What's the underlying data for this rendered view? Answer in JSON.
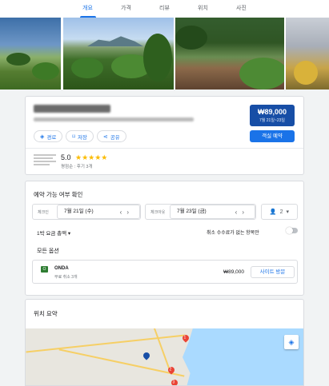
{
  "tabs": [
    {
      "label": "개요",
      "active": true
    },
    {
      "label": "가격",
      "active": false
    },
    {
      "label": "리뷰",
      "active": false
    },
    {
      "label": "위치",
      "active": false
    },
    {
      "label": "사진",
      "active": false
    }
  ],
  "hotel": {
    "chips": [
      {
        "icon": "directions-icon",
        "label": "경로"
      },
      {
        "icon": "bookmark-icon",
        "label": "저장"
      },
      {
        "icon": "share-icon",
        "label": "공유"
      }
    ],
    "price": "₩89,000",
    "price_dates": "7월 21일~23일",
    "book_label": "객실 예약",
    "rating": "5.0",
    "stars": "★★★★★",
    "rating_sub": "평점순 : 후기 3개"
  },
  "availability": {
    "title": "예약 가능 여부 확인",
    "checkin_label": "체크인",
    "checkin_value": "7월 21일 (수)",
    "checkout_label": "체크아웃",
    "checkout_value": "7월 23일 (금)",
    "guests": "2",
    "rate_select": "1박 요금 총액 ▾",
    "free_cancel": "취소 수수료가 없는 항목만",
    "all_options": "모든 옵션",
    "option": {
      "logo": "O",
      "name": "ONDA",
      "sub": "무료 취소 3개",
      "price": "₩89,000",
      "visit_label": "사이트 방문"
    }
  },
  "location": {
    "title": "위치 요약",
    "pins": [
      "1",
      "2",
      "3"
    ]
  },
  "colors": {
    "accent": "#1a73e8",
    "price_box": "#174ea6",
    "star": "#fbbc04",
    "pin_red": "#ea4335"
  }
}
